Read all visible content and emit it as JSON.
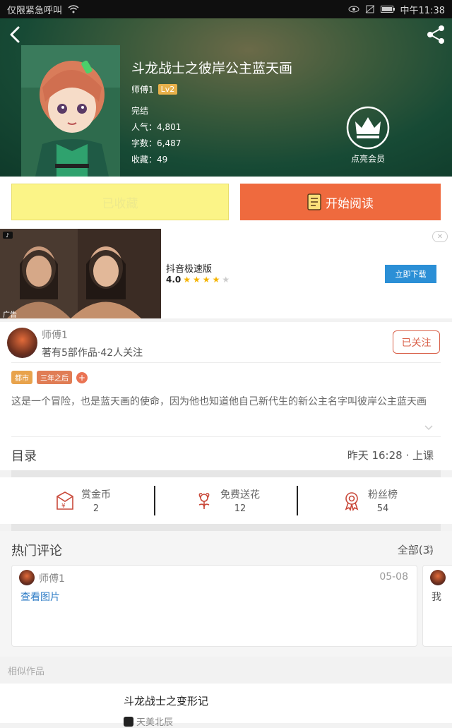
{
  "status_bar": {
    "carrier": "仅限紧急呼叫",
    "time": "中午11:38"
  },
  "book": {
    "title": "斗龙战士之彼岸公主蓝天画",
    "author": "师傅1",
    "level": "Lv2",
    "status": "完结",
    "popularity": "人气：4,801",
    "word_count": "字数：6,487",
    "favorites": "收藏：49",
    "vip_label": "点亮会员"
  },
  "actions": {
    "favorited_label": "已收藏",
    "read_label": "开始阅读"
  },
  "ad": {
    "app_name": "抖音极速版",
    "rating": "4.0",
    "stars": 4,
    "max_stars": 5,
    "cta": "立即下载",
    "tag": "广告",
    "close": "✕"
  },
  "author": {
    "name": "师傅1",
    "stats": "著有5部作品·42人关注",
    "follow_label": "已关注"
  },
  "tags": [
    {
      "label": "都市",
      "color": "#e8a34c"
    },
    {
      "label": "三年之后",
      "color": "#e07d55"
    }
  ],
  "tag_add": "+",
  "description": "这是一个冒险，也是蓝天画的使命，因为他也知道他自己新代生的新公主名字叫彼岸公主蓝天画",
  "toc": {
    "label": "目录",
    "latest": "昨天 16:28 · 上课"
  },
  "stats": [
    {
      "label": "赏金币",
      "value": "2",
      "icon": "red-envelope-icon"
    },
    {
      "label": "免费送花",
      "value": "12",
      "icon": "flower-icon"
    },
    {
      "label": "粉丝榜",
      "value": "54",
      "icon": "medal-icon"
    }
  ],
  "comments": {
    "title": "热门评论",
    "all_label": "全部(3)",
    "items": [
      {
        "user": "师傅1",
        "date": "05-08",
        "content": "查看图片"
      },
      {
        "content": "我"
      }
    ]
  },
  "similar": {
    "label": "相似作品",
    "title": "斗龙战士之变形记",
    "author": "天美北辰"
  },
  "colors": {
    "accent": "#ef6a3e",
    "favorite_bg": "#fbf487",
    "link": "#2c7bc6",
    "ad_button": "#2b8fd6"
  }
}
